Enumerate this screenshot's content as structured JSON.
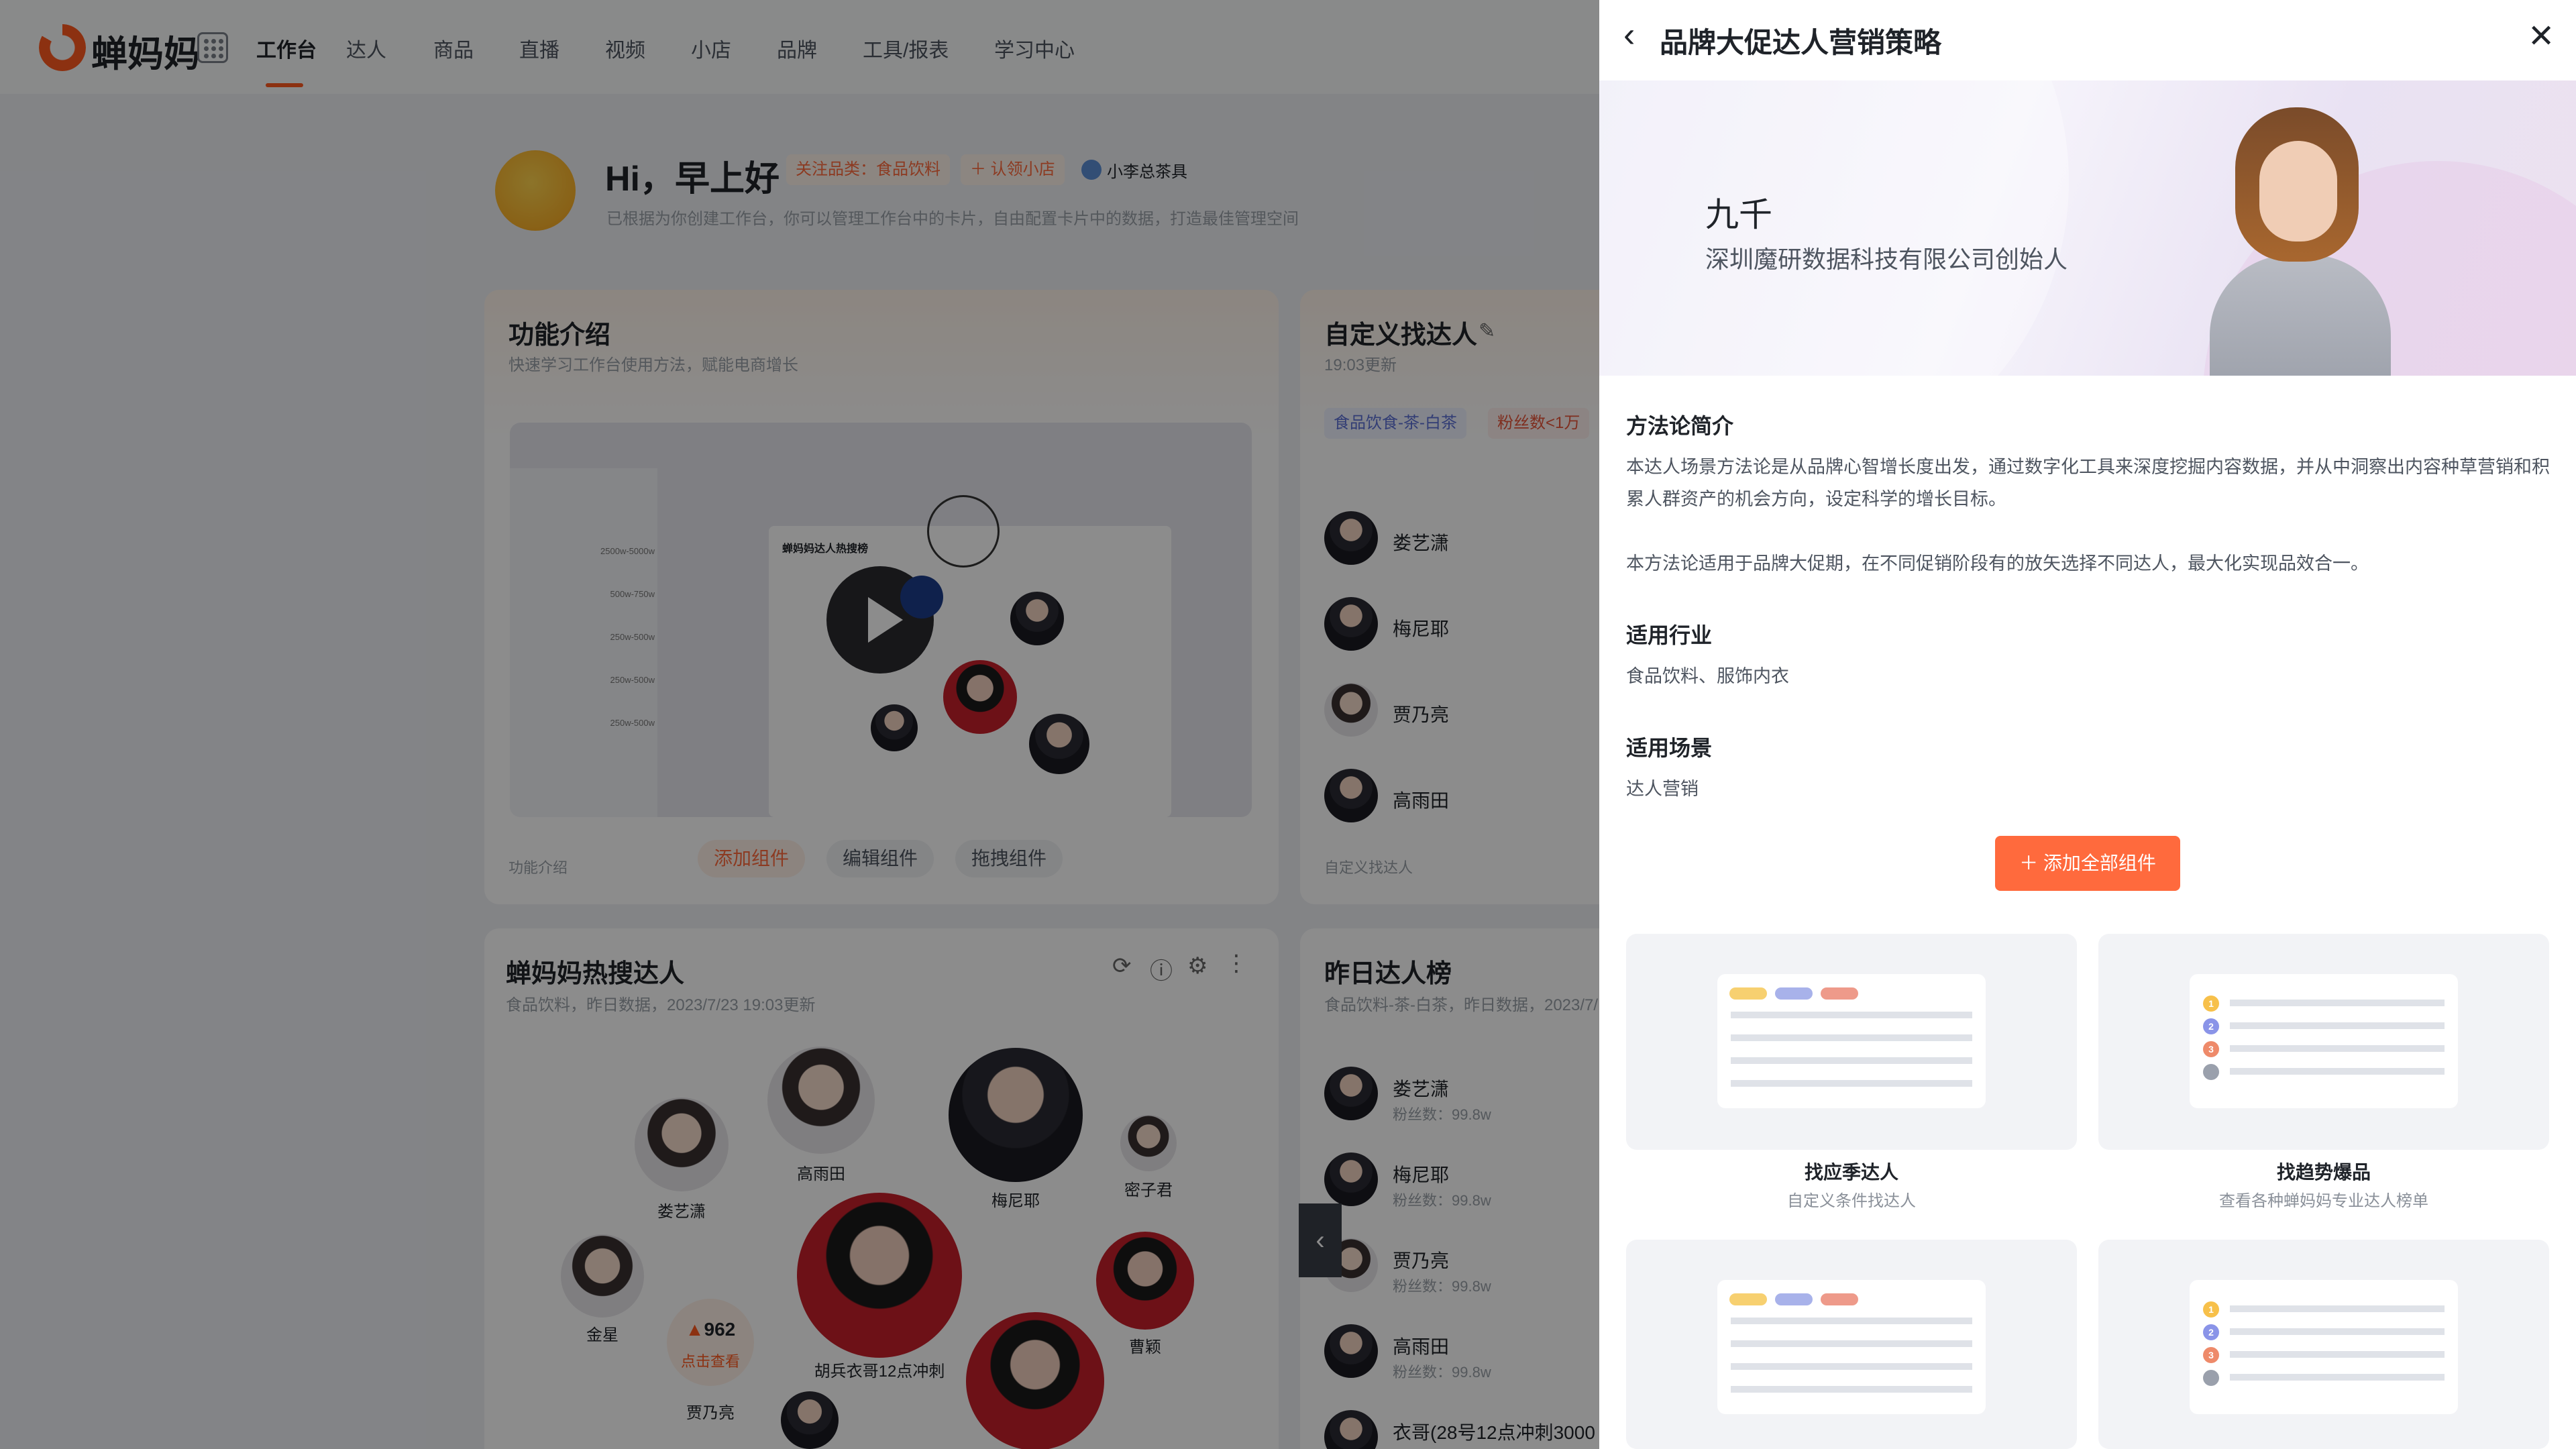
{
  "nav": {
    "logo": "蝉妈妈",
    "items": [
      "工作台",
      "达人",
      "商品",
      "直播",
      "视频",
      "小店",
      "品牌",
      "工具/报表",
      "学习中心"
    ]
  },
  "greeting": {
    "title": "Hi，早上好",
    "tag_focus": "关注品类：食品饮料",
    "tag_add_shop": "＋ 认领小店",
    "user": "小李总茶具",
    "subtitle": "已根据为你创建工作台，你可以管理工作台中的卡片，自由配置卡片中的数据，打造最佳管理空间"
  },
  "card_intro": {
    "title": "功能介绍",
    "subtitle": "快速学习工作台使用方法，赋能电商增长",
    "video_heading": "蝉妈妈达人热搜榜",
    "footer": "功能介绍",
    "btn_add": "添加组件",
    "btn_edit": "编辑组件",
    "btn_drag": "拖拽组件",
    "mini_values": [
      "2500w-5000w",
      "500w-750w",
      "250w-500w",
      "250w-500w",
      "250w-500w"
    ]
  },
  "card_custom": {
    "title": "自定义找达人",
    "updated": "19:03更新",
    "chip1": "食品饮食-茶-白茶",
    "chip2": "粉丝数<1万",
    "list": [
      "娄艺潇",
      "梅尼耶",
      "贾乃亮",
      "高雨田"
    ],
    "footer": "自定义找达人"
  },
  "card_hot": {
    "title": "蝉妈妈热搜达人",
    "subtitle": "食品饮料，昨日数据，2023/7/23 19:03更新",
    "bubbles": {
      "a": "娄艺潇",
      "b": "高雨田",
      "c": "梅尼耶",
      "d": "密子君",
      "e": "金星",
      "f": "胡兵衣哥12点冲刺",
      "g": "曹颖",
      "h": "贾乃亮"
    },
    "hot_count": "962",
    "hot_link": "点击查看"
  },
  "card_rank": {
    "title": "昨日达人榜",
    "subtitle": "食品饮料-茶-白茶，昨日数据，2023/7/",
    "rows": [
      {
        "name": "娄艺潇",
        "fans": "粉丝数：99.8w"
      },
      {
        "name": "梅尼耶",
        "fans": "粉丝数：99.8w"
      },
      {
        "name": "贾乃亮",
        "fans": "粉丝数：99.8w"
      },
      {
        "name": "高雨田",
        "fans": "粉丝数：99.8w"
      },
      {
        "name": "衣哥(28号12点冲刺3000",
        "fans": ""
      }
    ]
  },
  "drawer": {
    "title": "品牌大促达人营销策略",
    "presenter_name": "九千",
    "presenter_role": "深圳魔研数据科技有限公司创始人",
    "method_title": "方法论简介",
    "method_p1": "本达人场景方法论是从品牌心智增长度出发，通过数字化工具来深度挖掘内容数据，并从中洞察出内容种草营销和积累人群资产的机会方向，设定科学的增长目标。",
    "method_p2": "本方法论适用于品牌大促期，在不同促销阶段有的放矢选择不同达人，最大化实现品效合一。",
    "industry_title": "适用行业",
    "industry": "食品饮料、服饰内衣",
    "scene_title": "适用场景",
    "scene": "达人营销",
    "add_all": "添加全部组件",
    "components": [
      {
        "name": "找应季达人",
        "desc": "自定义条件找达人"
      },
      {
        "name": "找趋势爆品",
        "desc": "查看各种蝉妈妈专业达人榜单"
      }
    ]
  }
}
